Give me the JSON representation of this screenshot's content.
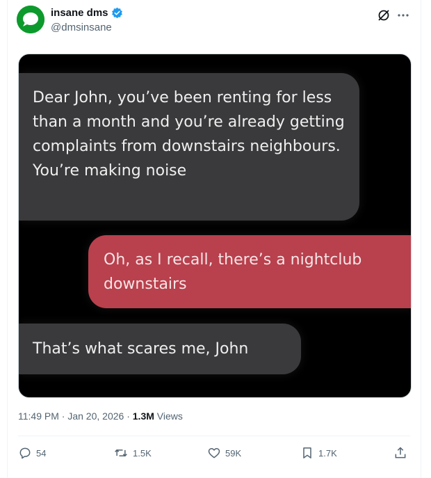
{
  "author": {
    "name": "insane dms",
    "handle": "@dmsinsane"
  },
  "messages": [
    {
      "side": "left",
      "text": "Dear John, you’ve been renting for less than a month and you’re already getting complaints from downstairs neighbours. You’re making noise"
    },
    {
      "side": "right",
      "text": "Oh, as I recall, there’s a nightclub downstairs"
    },
    {
      "side": "left",
      "text": "That’s what scares me, John"
    }
  ],
  "meta": {
    "time": "11:49 PM",
    "separator": "·",
    "date": "Jan 20, 2026",
    "views_count": "1.3M",
    "views_label": "Views"
  },
  "actions": {
    "replies": "54",
    "reposts": "1.5K",
    "likes": "59K",
    "bookmarks": "1.7K"
  },
  "icons": [
    "verified-badge-icon",
    "grok-icon",
    "more-icon",
    "reply-icon",
    "repost-icon",
    "like-icon",
    "bookmark-icon",
    "share-icon"
  ],
  "colors": {
    "accent": "#1d9bf0",
    "avatar": "#0a8a26",
    "bubble_grey": "#3a3a3c",
    "bubble_red": "#b9404d"
  }
}
